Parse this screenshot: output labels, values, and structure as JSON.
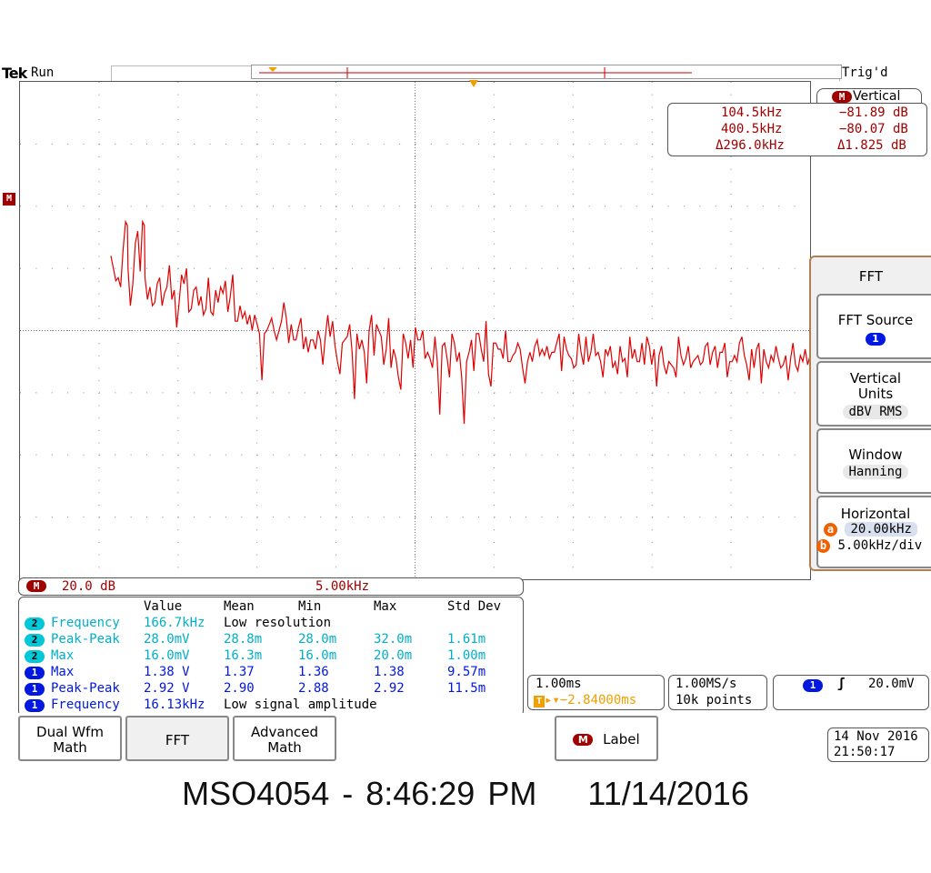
{
  "header": {
    "brand": "Tek",
    "run_state": "Run",
    "trigger_state": "Trig'd"
  },
  "cursor_readout": {
    "tab_label": "Vertical",
    "tab_badge": "M",
    "rows": [
      {
        "freq": "104.5kHz",
        "level": "−81.89 dB"
      },
      {
        "freq": "400.5kHz",
        "level": "−80.07 dB"
      },
      {
        "freq": "Δ296.0kHz",
        "level": "Δ1.825 dB"
      }
    ]
  },
  "side_menu": {
    "title": "FFT",
    "fft_source_label": "FFT Source",
    "fft_source_value": "1",
    "vertical_units_label": "Vertical Units",
    "vertical_units_value": "dBV RMS",
    "window_label": "Window",
    "window_value": "Hanning",
    "horizontal_label": "Horizontal",
    "horizontal_a_badge": "a",
    "horizontal_a_value": "20.00kHz",
    "horizontal_b_badge": "b",
    "horizontal_b_value": "5.00kHz/div"
  },
  "math_scale": {
    "badge": "M",
    "vertical": "20.0 dB",
    "horizontal": "5.00kHz"
  },
  "measurements": {
    "headers": [
      "Value",
      "Mean",
      "Min",
      "Max",
      "Std Dev"
    ],
    "rows": [
      {
        "ch": "2",
        "name": "Frequency",
        "value": "166.7kHz",
        "mean": "Low resolution",
        "min": "",
        "max": "",
        "std": ""
      },
      {
        "ch": "2",
        "name": "Peak-Peak",
        "value": "28.0mV",
        "mean": "28.8m",
        "min": "28.0m",
        "max": "32.0m",
        "std": "1.61m"
      },
      {
        "ch": "2",
        "name": "Max",
        "value": "16.0mV",
        "mean": "16.3m",
        "min": "16.0m",
        "max": "20.0m",
        "std": "1.00m"
      },
      {
        "ch": "1",
        "name": "Max",
        "value": "1.38 V",
        "mean": "1.37",
        "min": "1.36",
        "max": "1.38",
        "std": "9.57m"
      },
      {
        "ch": "1",
        "name": "Peak-Peak",
        "value": "2.92 V",
        "mean": "2.90",
        "min": "2.88",
        "max": "2.92",
        "std": "11.5m"
      },
      {
        "ch": "1",
        "name": "Frequency",
        "value": "16.13kHz",
        "mean": "Low signal amplitude",
        "min": "",
        "max": "",
        "std": ""
      }
    ]
  },
  "timebase": {
    "scale": "1.00ms",
    "trigger_position": "−2.84000ms",
    "sample_rate": "1.00MS/s",
    "record_length": "10k points"
  },
  "trigger": {
    "channel": "1",
    "slope": "↗",
    "level": "20.0mV"
  },
  "bottom_menu": {
    "dual_wfm_math": "Dual Wfm Math",
    "fft": "FFT",
    "advanced_math": "Advanced Math",
    "label_badge": "M",
    "label": "Label"
  },
  "datetime": {
    "date": "14 Nov 2016",
    "time": "21:50:17"
  },
  "caption": "MSO4054 - 8:46:29 PM    11/14/2016",
  "colors": {
    "math_trace": "#e00000",
    "ch1": "#0018e0",
    "ch2": "#00c8d8",
    "trigger_marker": "#f0a000"
  },
  "waveform": {
    "values_db": [
      -56,
      -60,
      -64,
      -63,
      -66,
      -54,
      -48,
      -60,
      -72,
      -65,
      -52,
      -48,
      -61,
      -62,
      -63,
      -70,
      -66,
      -72,
      -71,
      -65,
      -63,
      -72,
      -68,
      -66,
      -59,
      -70,
      -67,
      -79,
      -71,
      -62,
      -65,
      -60,
      -74,
      -73,
      -67,
      -66,
      -72,
      -69,
      -75,
      -73,
      -63,
      -74,
      -75,
      -67,
      -71,
      -66,
      -68,
      -64,
      -74,
      -69,
      -62,
      -77,
      -77,
      -72,
      -76,
      -74,
      -78,
      -75,
      -80,
      -75,
      -78,
      -81,
      -76,
      -81,
      -80,
      -78,
      -76,
      -80,
      -83,
      -80,
      -77,
      -71,
      -76,
      -84,
      -78,
      -83,
      -83,
      -79,
      -76,
      -86,
      -82,
      -87,
      -83,
      -83,
      -86,
      -80,
      -83,
      -91,
      -82,
      -75,
      -82,
      -77,
      -85,
      -90,
      -94,
      -84,
      -83,
      -82,
      -78,
      -87,
      -102,
      -81,
      -86,
      -83,
      -87,
      -97,
      -80,
      -75,
      -88,
      -78,
      -80,
      -82,
      -91,
      -86,
      -76,
      -83,
      -86,
      -89,
      -95,
      -99,
      -81,
      -84,
      -89,
      -83,
      -92,
      -79,
      -83,
      -83,
      -80,
      -89,
      -87,
      -89,
      -92,
      -82,
      -90,
      -87,
      -85,
      -84,
      -89,
      -95,
      -81,
      -84,
      -90,
      -87,
      -95,
      -110,
      -90,
      -87,
      -83,
      -93,
      -81,
      -81,
      -86,
      -90,
      -77,
      -94,
      -98,
      -84,
      -84,
      -86,
      -86,
      -89,
      -80,
      -90,
      -90,
      -88,
      -87,
      -84,
      -86,
      -92,
      -97,
      -90,
      -87,
      -90,
      -85,
      -83,
      -88,
      -86,
      -88,
      -85,
      -89,
      -87,
      -87,
      -84,
      -81,
      -93,
      -82,
      -86,
      -88,
      -89,
      -92,
      -91,
      -81,
      -87,
      -91,
      -82,
      -90,
      -87,
      -81,
      -88,
      -87,
      -90,
      -95,
      -86,
      -88,
      -85,
      -92,
      -90,
      -94,
      -85,
      -90,
      -89,
      -95,
      -82,
      -89,
      -86,
      -90,
      -90,
      -84,
      -91,
      -82,
      -85,
      -91,
      -86,
      -98,
      -88,
      -85,
      -91,
      -94,
      -90,
      -91,
      -92,
      -95,
      -82,
      -88,
      -91,
      -89,
      -85,
      -92,
      -90,
      -89,
      -88,
      -91,
      -90,
      -85,
      -84,
      -91,
      -87,
      -85,
      -92,
      -87,
      -87,
      -84,
      -95,
      -90,
      -90,
      -88,
      -90,
      -84,
      -82,
      -88,
      -91,
      -96,
      -86,
      -92,
      -86,
      -84,
      -97,
      -86,
      -90,
      -92,
      -88,
      -90,
      -85,
      -89,
      -92,
      -91,
      -88,
      -96,
      -89,
      -84,
      -91,
      -93,
      -88,
      -90,
      -86,
      -91,
      -88
    ],
    "peaks": [
      {
        "index": 6,
        "db": -45
      },
      {
        "index": 13,
        "db": -45
      },
      {
        "index": 62,
        "db": -96
      },
      {
        "index": 115,
        "db": -92
      },
      {
        "index": 135,
        "db": -107
      }
    ],
    "ref_db": -80,
    "db_per_div": 20,
    "x_start_khz": 0,
    "khz_per_div": 5
  }
}
